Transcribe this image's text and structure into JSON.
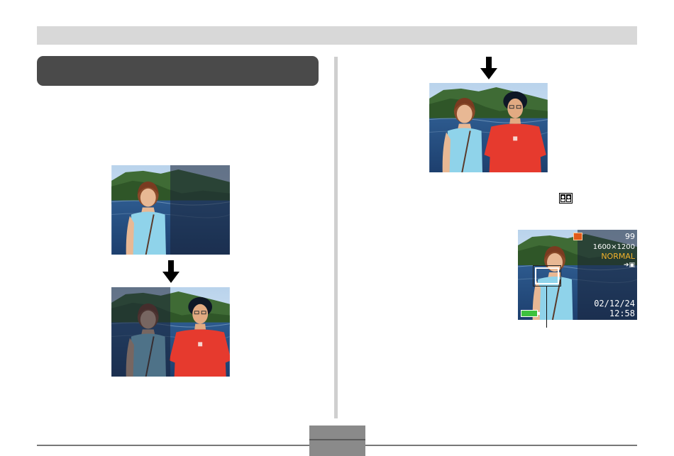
{
  "lcd": {
    "shots_remaining": "99",
    "resolution": "1600×1200",
    "quality": "NORMAL",
    "date": "02/12/24",
    "time": "12:58"
  },
  "icons": {
    "down_arrow": "down-arrow-icon",
    "mode": "portrait-pair-icon",
    "battery": "battery-icon",
    "flash": "flash-icon"
  }
}
